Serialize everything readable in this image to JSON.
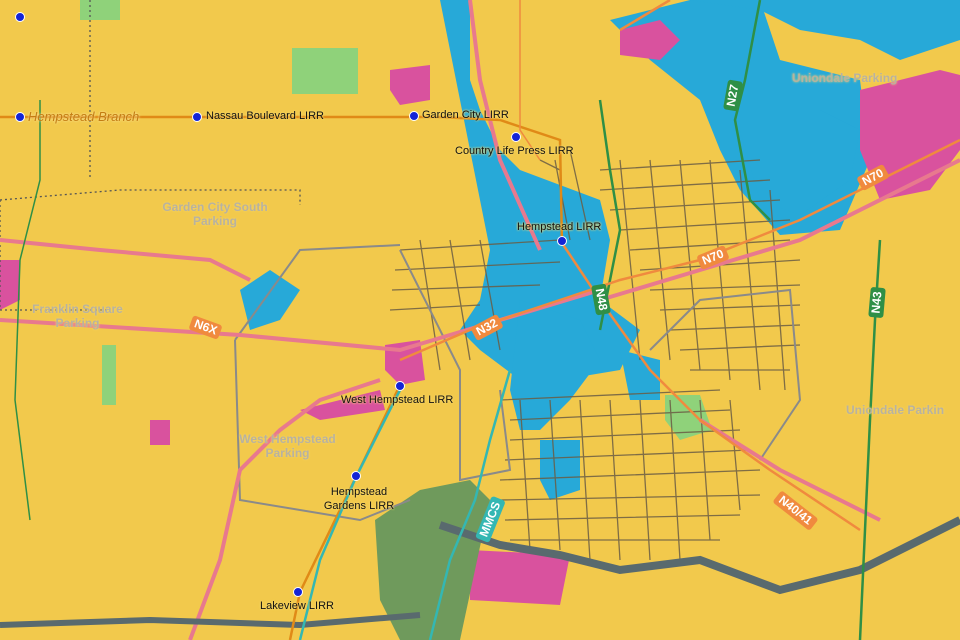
{
  "branch": {
    "label": "Hempstead Branch"
  },
  "stations": [
    {
      "id": "nassau",
      "label": "Nassau Boulevard LIRR"
    },
    {
      "id": "gardencity",
      "label": "Garden City LIRR"
    },
    {
      "id": "countrylife",
      "label": "Country Life Press LIRR"
    },
    {
      "id": "hempstead",
      "label": "Hempstead LIRR"
    },
    {
      "id": "westhempstead",
      "label": "West Hempstead LIRR"
    },
    {
      "id": "hempsteadgardens",
      "label": "Hempstead Gardens LIRR"
    },
    {
      "id": "lakeview",
      "label": "Lakeview LIRR"
    }
  ],
  "parking": [
    {
      "id": "gardencity-south",
      "label": "Garden City South Parking"
    },
    {
      "id": "franklin",
      "label": "Franklin Square Parking"
    },
    {
      "id": "westhempstead",
      "label": "West Hempstead Parking"
    },
    {
      "id": "uniondale-1",
      "label": "Uniondale Parking"
    },
    {
      "id": "uniondale-2",
      "label": "Uniondale Parkin"
    }
  ],
  "routes": [
    {
      "id": "n27",
      "label": "N27",
      "color": "#2f8f46"
    },
    {
      "id": "n70-east",
      "label": "N70",
      "color": "#f08a3e"
    },
    {
      "id": "n70-mid",
      "label": "N70",
      "color": "#f08a3e"
    },
    {
      "id": "n48",
      "label": "N48",
      "color": "#2f8f46"
    },
    {
      "id": "n43",
      "label": "N43",
      "color": "#2f8f46"
    },
    {
      "id": "n32",
      "label": "N32",
      "color": "#f08a3e"
    },
    {
      "id": "n6x",
      "label": "N6X",
      "color": "#f08a3e"
    },
    {
      "id": "n40",
      "label": "N40/41",
      "color": "#f08a3e"
    },
    {
      "id": "mmcs",
      "label": "MMCS",
      "color": "#34b7b3"
    }
  ],
  "colors": {
    "residential": "#f2c94c",
    "commercial": "#27a9d8",
    "industrial": "#d9529e",
    "parkland": "#6f9a5c",
    "grass": "#8fd27a",
    "lirr_line": "#e08a17",
    "bus_orange": "#f08a3e",
    "bus_green": "#2f8f46",
    "bus_teal": "#34b7b3",
    "station_dot": "#1424d6"
  }
}
